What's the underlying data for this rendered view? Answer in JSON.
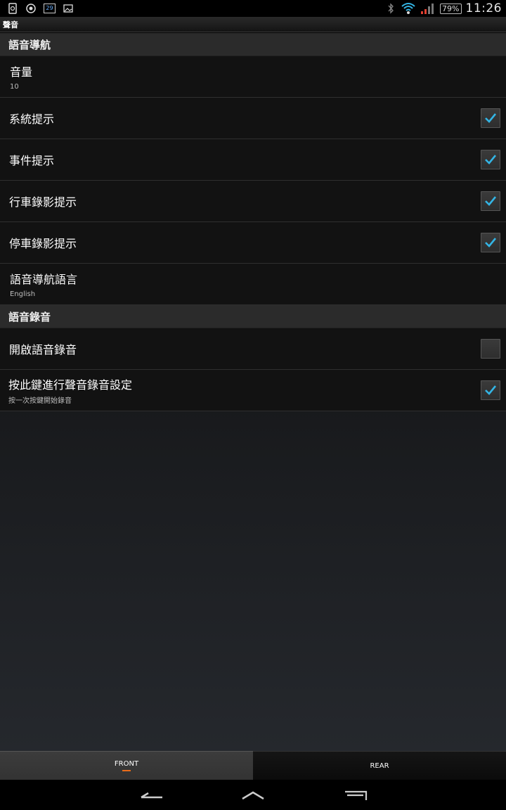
{
  "status_bar": {
    "battery": "79%",
    "time": "11:26",
    "icons": [
      "sim-icon",
      "sync-icon",
      "calendar-icon",
      "image-icon",
      "bluetooth-icon",
      "wifi-icon",
      "signal-icon",
      "battery-icon"
    ],
    "calendar_day": "29"
  },
  "title_bar": {
    "title": "聲音"
  },
  "sections": {
    "nav": {
      "header": "語音導航",
      "volume": {
        "title": "音量",
        "summary": "10"
      },
      "system_prompt": {
        "title": "系統提示",
        "checked": true
      },
      "event_prompt": {
        "title": "事件提示",
        "checked": true
      },
      "driving_rec_prompt": {
        "title": "行車錄影提示",
        "checked": true
      },
      "parking_rec_prompt": {
        "title": "停車錄影提示",
        "checked": true
      },
      "nav_language": {
        "title": "語音導航語言",
        "summary": "English"
      }
    },
    "recording": {
      "header": "語音錄音",
      "enable_voice_rec": {
        "title": "開啟語音錄音",
        "checked": false
      },
      "key_rec_setting": {
        "title": "按此鍵進行聲音錄音設定",
        "summary": "按一次按鍵開始錄音",
        "checked": true
      }
    }
  },
  "tabs": {
    "front": "FRONT",
    "rear": "REAR"
  },
  "colors": {
    "accent": "#33b5e5",
    "tab_indicator": "#e86c1a"
  }
}
